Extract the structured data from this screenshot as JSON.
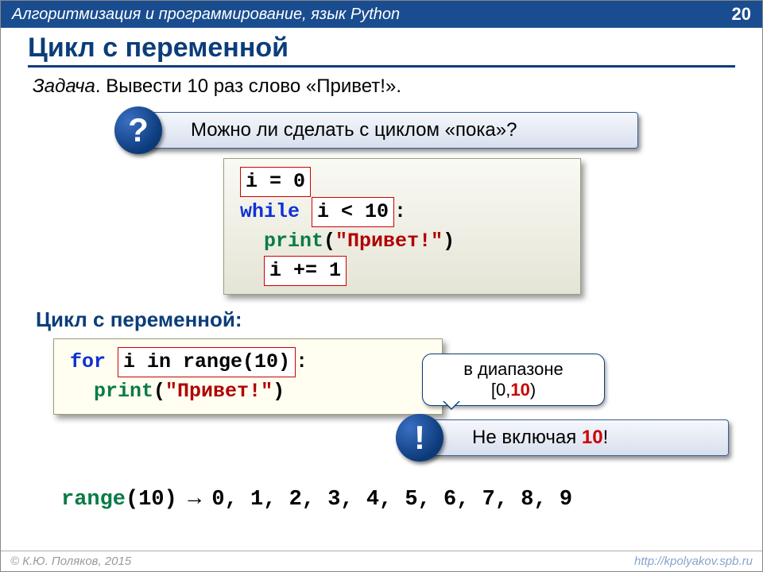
{
  "header": {
    "crumb": "Алгоритмизация и программирование, язык Python",
    "page": "20"
  },
  "title": "Цикл с переменной",
  "task": {
    "label": "Задача",
    "text": ". Вывести 10 раз слово «Привет!»."
  },
  "q1": {
    "badge": "?",
    "text": "Можно ли сделать с циклом «пока»?"
  },
  "code1": {
    "l1_box": "i = 0",
    "l2_kw": "while",
    "l2_box": "i < 10",
    "l2_colon": ":",
    "l3_fn": "print",
    "l3_paren_open": "(",
    "l3_str": "\"Привет!\"",
    "l3_paren_close": ")",
    "l4_box": "i += 1"
  },
  "subhead": "Цикл с переменной:",
  "bubble": {
    "line1": "в диапазоне",
    "line2_a": "[0,",
    "line2_b": "10",
    "line2_c": ")"
  },
  "code2": {
    "l1_kw": "for",
    "l1_box": "i in range(10)",
    "l1_colon": ":",
    "l2_fn": "print",
    "l2_paren_open": "(",
    "l2_str": "\"Привет!\"",
    "l2_paren_close": ")"
  },
  "ex": {
    "badge": "!",
    "text_a": "Не включая ",
    "text_b": "10",
    "text_c": "!"
  },
  "rangeLine": {
    "fn": "range",
    "args": "(10)",
    "arrow": " → ",
    "values": "0, 1, 2, 3, 4, 5, 6, 7, 8, 9"
  },
  "footer": {
    "left": "© К.Ю. Поляков, 2015",
    "right": "http://kpolyakov.spb.ru"
  }
}
